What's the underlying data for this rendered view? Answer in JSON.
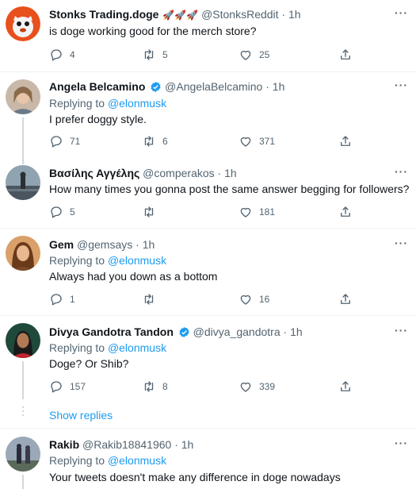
{
  "tweets": [
    {
      "name": "Stonks Trading.doge",
      "emoji": "🚀🚀🚀",
      "handle": "@StonksReddit",
      "time": "1h",
      "text": "is doge working good for the merch store?",
      "replies": "4",
      "retweets": "5",
      "likes": "25"
    },
    {
      "name": "Angela Belcamino",
      "handle": "@AngelaBelcamino",
      "time": "1h",
      "replying_prefix": "Replying to",
      "replying_to": "@elonmusk",
      "text": "I prefer doggy style.",
      "replies": "71",
      "retweets": "6",
      "likes": "371"
    },
    {
      "name": "Βασίλης Αγγέλης",
      "handle": "@comperakos",
      "time": "1h",
      "text": "How many times you gonna post the same answer begging for followers?",
      "replies": "5",
      "retweets": "",
      "likes": "181"
    },
    {
      "name": "Gem",
      "handle": "@gemsays",
      "time": "1h",
      "replying_prefix": "Replying to",
      "replying_to": "@elonmusk",
      "text": "Always had you down as a bottom",
      "replies": "1",
      "retweets": "",
      "likes": "16"
    },
    {
      "name": "Divya Gandotra Tandon",
      "handle": "@divya_gandotra",
      "time": "1h",
      "replying_prefix": "Replying to",
      "replying_to": "@elonmusk",
      "text": "Doge? Or Shib?",
      "replies": "157",
      "retweets": "8",
      "likes": "339"
    },
    {
      "name": "Rakib",
      "handle": "@Rakib18841960",
      "time": "1h",
      "replying_prefix": "Replying to",
      "replying_to": "@elonmusk",
      "text": "Your tweets doesn't make any difference in doge nowadays"
    }
  ],
  "show_replies": "Show replies",
  "more_label": "···",
  "sep": " · ",
  "icons": {
    "reply": "reply-icon",
    "retweet": "retweet-icon",
    "like": "heart-icon",
    "share": "share-icon",
    "verified": "verified-badge-icon",
    "more": "more-options-icon"
  },
  "colors": {
    "accent": "#1d9bf0",
    "secondary_text": "#536471",
    "divider": "#eff3f4"
  }
}
